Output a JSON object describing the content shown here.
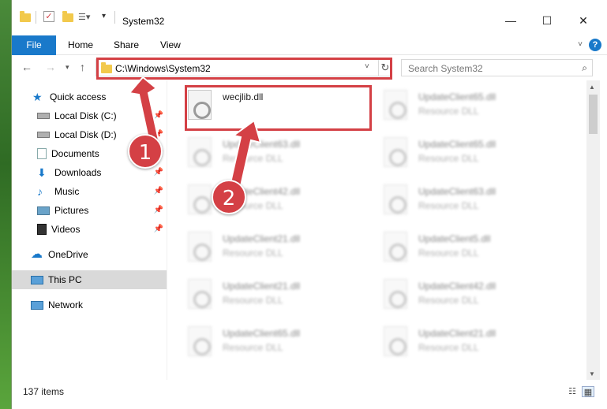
{
  "window": {
    "title": "System32",
    "controls": {
      "minimize": "—",
      "maximize": "☐",
      "close": "✕"
    }
  },
  "ribbon": {
    "tabs": [
      "File",
      "Home",
      "Share",
      "View"
    ],
    "help_label": "?"
  },
  "navigation": {
    "address": "C:\\Windows\\System32",
    "search_placeholder": "Search System32"
  },
  "sidebar": {
    "items": [
      {
        "label": "Quick access",
        "icon": "star-icon",
        "pinned": false
      },
      {
        "label": "Local Disk (C:)",
        "icon": "drive-icon",
        "pinned": true
      },
      {
        "label": "Local Disk (D:)",
        "icon": "drive-icon",
        "pinned": true
      },
      {
        "label": "Documents",
        "icon": "documents-icon",
        "pinned": true
      },
      {
        "label": "Downloads",
        "icon": "download-icon",
        "pinned": true
      },
      {
        "label": "Music",
        "icon": "music-icon",
        "pinned": true
      },
      {
        "label": "Pictures",
        "icon": "pictures-icon",
        "pinned": true
      },
      {
        "label": "Videos",
        "icon": "videos-icon",
        "pinned": true
      },
      {
        "label": "OneDrive",
        "icon": "cloud-icon",
        "pinned": false
      },
      {
        "label": "This PC",
        "icon": "computer-icon",
        "pinned": false,
        "selected": true
      },
      {
        "label": "Network",
        "icon": "network-icon",
        "pinned": false
      }
    ]
  },
  "files": {
    "highlighted": {
      "name": "wecjlib.dll",
      "type": ""
    },
    "col1": [
      {
        "name": "UpdateClient63.dll",
        "type": "Resource DLL"
      },
      {
        "name": "UpdateClient42.dll",
        "type": "Resource DLL"
      },
      {
        "name": "UpdateClient21.dll",
        "type": "Resource DLL"
      },
      {
        "name": "UpdateClient21.dll",
        "type": "Resource DLL"
      },
      {
        "name": "UpdateClient65.dll",
        "type": "Resource DLL"
      }
    ],
    "col2": [
      {
        "name": "UpdateClient65.dll",
        "type": "Resource DLL"
      },
      {
        "name": "UpdateClient65.dll",
        "type": "Resource DLL"
      },
      {
        "name": "UpdateClient63.dll",
        "type": "Resource DLL"
      },
      {
        "name": "UpdateClient5.dll",
        "type": "Resource DLL"
      },
      {
        "name": "UpdateClient42.dll",
        "type": "Resource DLL"
      },
      {
        "name": "UpdateClient21.dll",
        "type": "Resource DLL"
      }
    ]
  },
  "status": {
    "item_count": "137 items"
  },
  "annotations": {
    "step1": "1",
    "step2": "2",
    "accent": "#d44045"
  }
}
